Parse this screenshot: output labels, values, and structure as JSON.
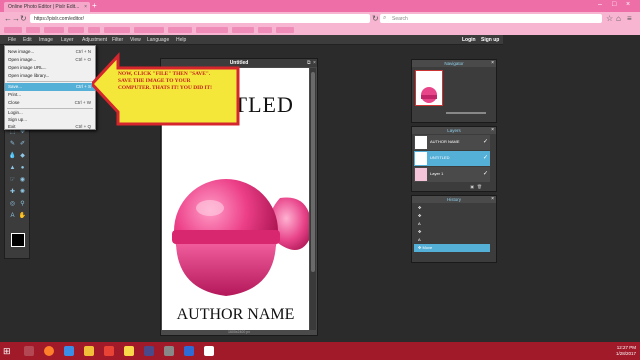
{
  "browser": {
    "tabs": [
      {
        "label": "Online Photo Editor | Pixlr Edit..."
      }
    ],
    "address": "https://pixlr.com/editor/",
    "search_placeholder": "Search",
    "bookmarks": [
      "",
      "",
      "",
      "",
      "",
      "",
      "",
      "",
      "",
      "",
      "",
      ""
    ]
  },
  "menubar": {
    "items": [
      "File",
      "Edit",
      "Image",
      "Layer",
      "Adjustment",
      "Filter",
      "View",
      "Language",
      "Help"
    ],
    "login": "Login",
    "signup": "Sign up"
  },
  "file_menu": {
    "items": [
      {
        "label": "New image...",
        "shortcut": "Ctrl + N"
      },
      {
        "label": "Open image...",
        "shortcut": "Ctrl + O"
      },
      {
        "label": "Open image URL...",
        "shortcut": ""
      },
      {
        "label": "Open image library...",
        "shortcut": ""
      },
      {
        "label": "Save...",
        "shortcut": "Ctrl + S"
      },
      {
        "label": "Print...",
        "shortcut": ""
      },
      {
        "label": "Close",
        "shortcut": "Ctrl + W"
      },
      {
        "label": "Login...",
        "shortcut": ""
      },
      {
        "label": "Sign up...",
        "shortcut": ""
      },
      {
        "label": "Exit",
        "shortcut": "Ctrl + Q"
      }
    ]
  },
  "callout": {
    "text": "NOW, CLICK \"FILE\" THEN \"SAVE\". SAVE THE IMAGE TO YOUR COMPUTER. THATS IT! YOU DID IT!"
  },
  "document": {
    "title": "Untitled",
    "canvas_title": "UNTITLED",
    "canvas_author": "AUTHOR NAME",
    "status": "1600x2400 px"
  },
  "navigator": {
    "title": "Navigator"
  },
  "layers": {
    "title": "Layers",
    "rows": [
      {
        "name": "AUTHOR NAME"
      },
      {
        "name": "UNTITLED"
      },
      {
        "name": "Layer 1"
      }
    ]
  },
  "history": {
    "title": "History",
    "rows": [
      "",
      "",
      "",
      "",
      "",
      "Move"
    ]
  },
  "taskbar": {
    "time": "12:27 PM",
    "date": "1/28/2017"
  },
  "colors": {
    "browser_pink": "#ee6fa8",
    "highlight_blue": "#55b0d8",
    "arrow_yellow": "#f5e63a",
    "arrow_red": "#d4262c",
    "taskbar": "#a01a2a"
  }
}
